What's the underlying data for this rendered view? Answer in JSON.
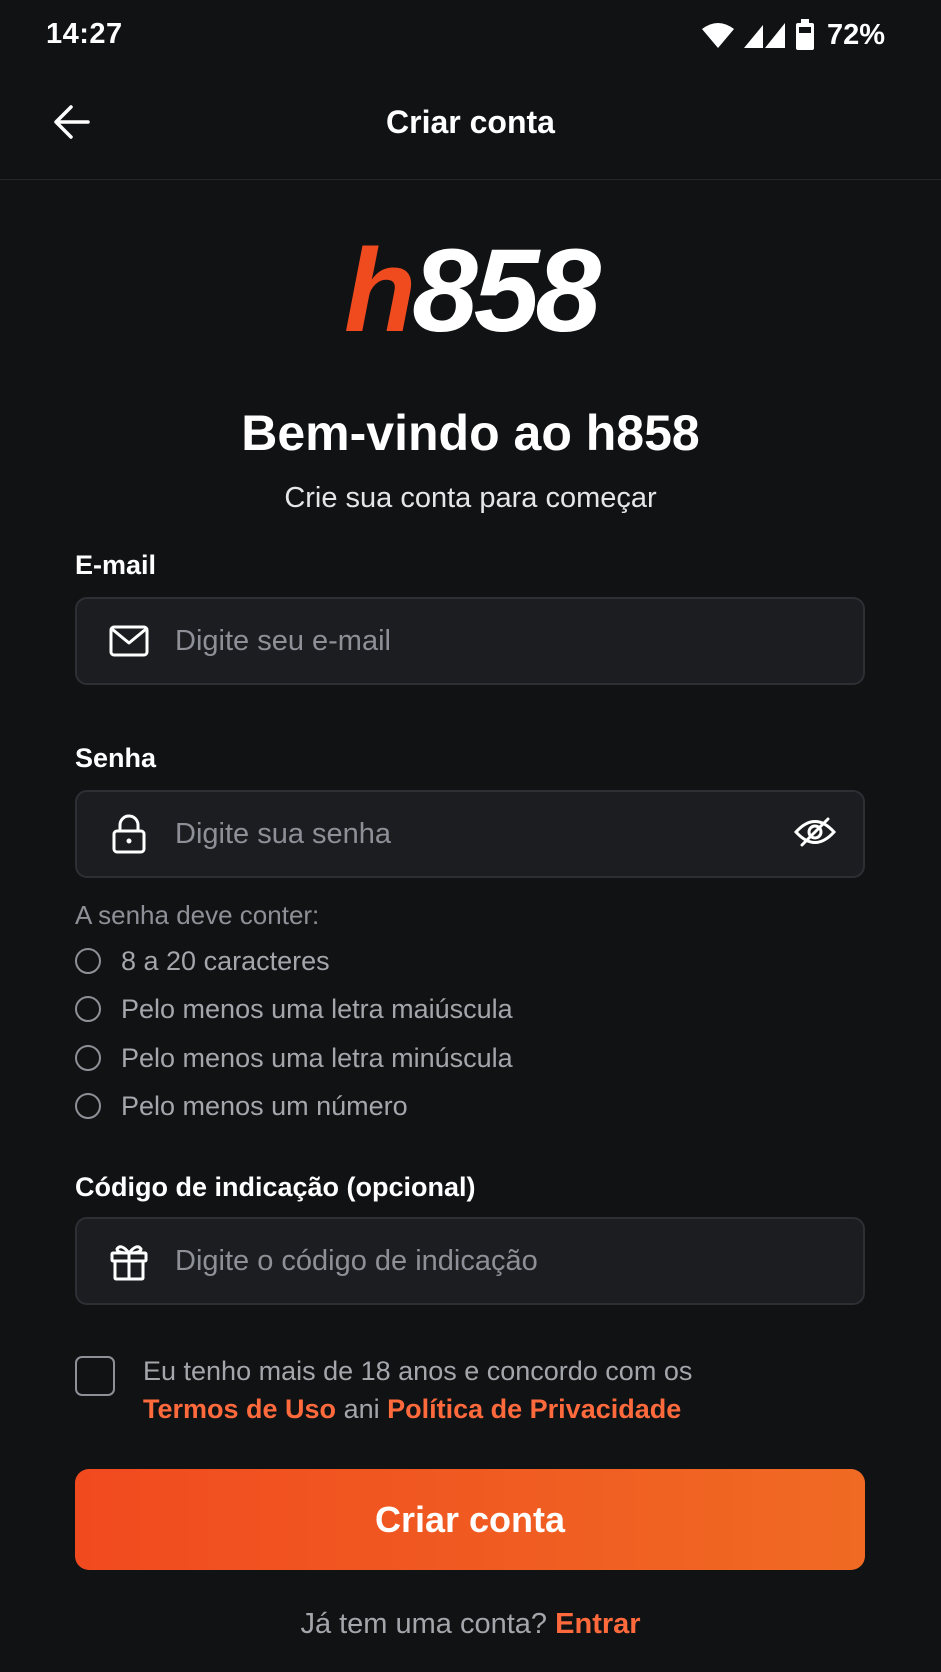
{
  "status_bar": {
    "time": "14:27",
    "battery": "72%"
  },
  "header": {
    "title": "Criar conta"
  },
  "logo": {
    "part_accent": "h",
    "part_main": "858"
  },
  "welcome": {
    "title": "Bem-vindo ao h858",
    "subtitle": "Crie sua conta para começar"
  },
  "email": {
    "label": "E-mail",
    "placeholder": "Digite seu e-mail",
    "value": ""
  },
  "password": {
    "label": "Senha",
    "placeholder": "Digite sua senha",
    "value": "",
    "rules_title": "A senha deve conter:",
    "rules": [
      "8 a 20 caracteres",
      "Pelo menos uma letra maiúscula",
      "Pelo menos uma letra minúscula",
      "Pelo menos um número"
    ]
  },
  "referral": {
    "label": "Código de indicação (opcional)",
    "placeholder": "Digite o código de indicação",
    "value": ""
  },
  "terms": {
    "line1": "Eu tenho mais de 18 anos e concordo com os",
    "terms_link": "Termos de Uso",
    "connector": "ani",
    "privacy_link": "Política de Privacidade",
    "checked": false
  },
  "submit": {
    "label": "Criar conta"
  },
  "login": {
    "prompt": "Já tem uma conta?",
    "link": "Entrar"
  },
  "colors": {
    "accent": "#f04a1f",
    "background": "#111214",
    "field_bg": "#1b1d21",
    "link": "#ff6a3d"
  }
}
